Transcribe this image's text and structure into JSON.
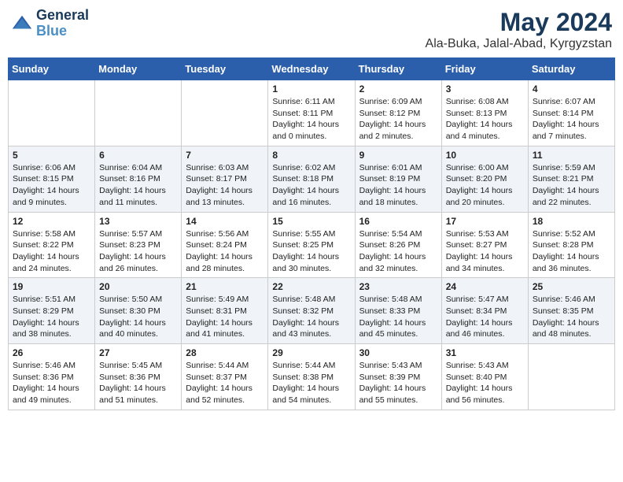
{
  "logo": {
    "line1": "General",
    "line2": "Blue"
  },
  "title": "May 2024",
  "subtitle": "Ala-Buka, Jalal-Abad, Kyrgyzstan",
  "headers": [
    "Sunday",
    "Monday",
    "Tuesday",
    "Wednesday",
    "Thursday",
    "Friday",
    "Saturday"
  ],
  "weeks": [
    [
      {
        "day": "",
        "sunrise": "",
        "sunset": "",
        "daylight": ""
      },
      {
        "day": "",
        "sunrise": "",
        "sunset": "",
        "daylight": ""
      },
      {
        "day": "",
        "sunrise": "",
        "sunset": "",
        "daylight": ""
      },
      {
        "day": "1",
        "sunrise": "6:11 AM",
        "sunset": "8:11 PM",
        "daylight": "14 hours and 0 minutes."
      },
      {
        "day": "2",
        "sunrise": "6:09 AM",
        "sunset": "8:12 PM",
        "daylight": "14 hours and 2 minutes."
      },
      {
        "day": "3",
        "sunrise": "6:08 AM",
        "sunset": "8:13 PM",
        "daylight": "14 hours and 4 minutes."
      },
      {
        "day": "4",
        "sunrise": "6:07 AM",
        "sunset": "8:14 PM",
        "daylight": "14 hours and 7 minutes."
      }
    ],
    [
      {
        "day": "5",
        "sunrise": "6:06 AM",
        "sunset": "8:15 PM",
        "daylight": "14 hours and 9 minutes."
      },
      {
        "day": "6",
        "sunrise": "6:04 AM",
        "sunset": "8:16 PM",
        "daylight": "14 hours and 11 minutes."
      },
      {
        "day": "7",
        "sunrise": "6:03 AM",
        "sunset": "8:17 PM",
        "daylight": "14 hours and 13 minutes."
      },
      {
        "day": "8",
        "sunrise": "6:02 AM",
        "sunset": "8:18 PM",
        "daylight": "14 hours and 16 minutes."
      },
      {
        "day": "9",
        "sunrise": "6:01 AM",
        "sunset": "8:19 PM",
        "daylight": "14 hours and 18 minutes."
      },
      {
        "day": "10",
        "sunrise": "6:00 AM",
        "sunset": "8:20 PM",
        "daylight": "14 hours and 20 minutes."
      },
      {
        "day": "11",
        "sunrise": "5:59 AM",
        "sunset": "8:21 PM",
        "daylight": "14 hours and 22 minutes."
      }
    ],
    [
      {
        "day": "12",
        "sunrise": "5:58 AM",
        "sunset": "8:22 PM",
        "daylight": "14 hours and 24 minutes."
      },
      {
        "day": "13",
        "sunrise": "5:57 AM",
        "sunset": "8:23 PM",
        "daylight": "14 hours and 26 minutes."
      },
      {
        "day": "14",
        "sunrise": "5:56 AM",
        "sunset": "8:24 PM",
        "daylight": "14 hours and 28 minutes."
      },
      {
        "day": "15",
        "sunrise": "5:55 AM",
        "sunset": "8:25 PM",
        "daylight": "14 hours and 30 minutes."
      },
      {
        "day": "16",
        "sunrise": "5:54 AM",
        "sunset": "8:26 PM",
        "daylight": "14 hours and 32 minutes."
      },
      {
        "day": "17",
        "sunrise": "5:53 AM",
        "sunset": "8:27 PM",
        "daylight": "14 hours and 34 minutes."
      },
      {
        "day": "18",
        "sunrise": "5:52 AM",
        "sunset": "8:28 PM",
        "daylight": "14 hours and 36 minutes."
      }
    ],
    [
      {
        "day": "19",
        "sunrise": "5:51 AM",
        "sunset": "8:29 PM",
        "daylight": "14 hours and 38 minutes."
      },
      {
        "day": "20",
        "sunrise": "5:50 AM",
        "sunset": "8:30 PM",
        "daylight": "14 hours and 40 minutes."
      },
      {
        "day": "21",
        "sunrise": "5:49 AM",
        "sunset": "8:31 PM",
        "daylight": "14 hours and 41 minutes."
      },
      {
        "day": "22",
        "sunrise": "5:48 AM",
        "sunset": "8:32 PM",
        "daylight": "14 hours and 43 minutes."
      },
      {
        "day": "23",
        "sunrise": "5:48 AM",
        "sunset": "8:33 PM",
        "daylight": "14 hours and 45 minutes."
      },
      {
        "day": "24",
        "sunrise": "5:47 AM",
        "sunset": "8:34 PM",
        "daylight": "14 hours and 46 minutes."
      },
      {
        "day": "25",
        "sunrise": "5:46 AM",
        "sunset": "8:35 PM",
        "daylight": "14 hours and 48 minutes."
      }
    ],
    [
      {
        "day": "26",
        "sunrise": "5:46 AM",
        "sunset": "8:36 PM",
        "daylight": "14 hours and 49 minutes."
      },
      {
        "day": "27",
        "sunrise": "5:45 AM",
        "sunset": "8:36 PM",
        "daylight": "14 hours and 51 minutes."
      },
      {
        "day": "28",
        "sunrise": "5:44 AM",
        "sunset": "8:37 PM",
        "daylight": "14 hours and 52 minutes."
      },
      {
        "day": "29",
        "sunrise": "5:44 AM",
        "sunset": "8:38 PM",
        "daylight": "14 hours and 54 minutes."
      },
      {
        "day": "30",
        "sunrise": "5:43 AM",
        "sunset": "8:39 PM",
        "daylight": "14 hours and 55 minutes."
      },
      {
        "day": "31",
        "sunrise": "5:43 AM",
        "sunset": "8:40 PM",
        "daylight": "14 hours and 56 minutes."
      },
      {
        "day": "",
        "sunrise": "",
        "sunset": "",
        "daylight": ""
      }
    ]
  ]
}
